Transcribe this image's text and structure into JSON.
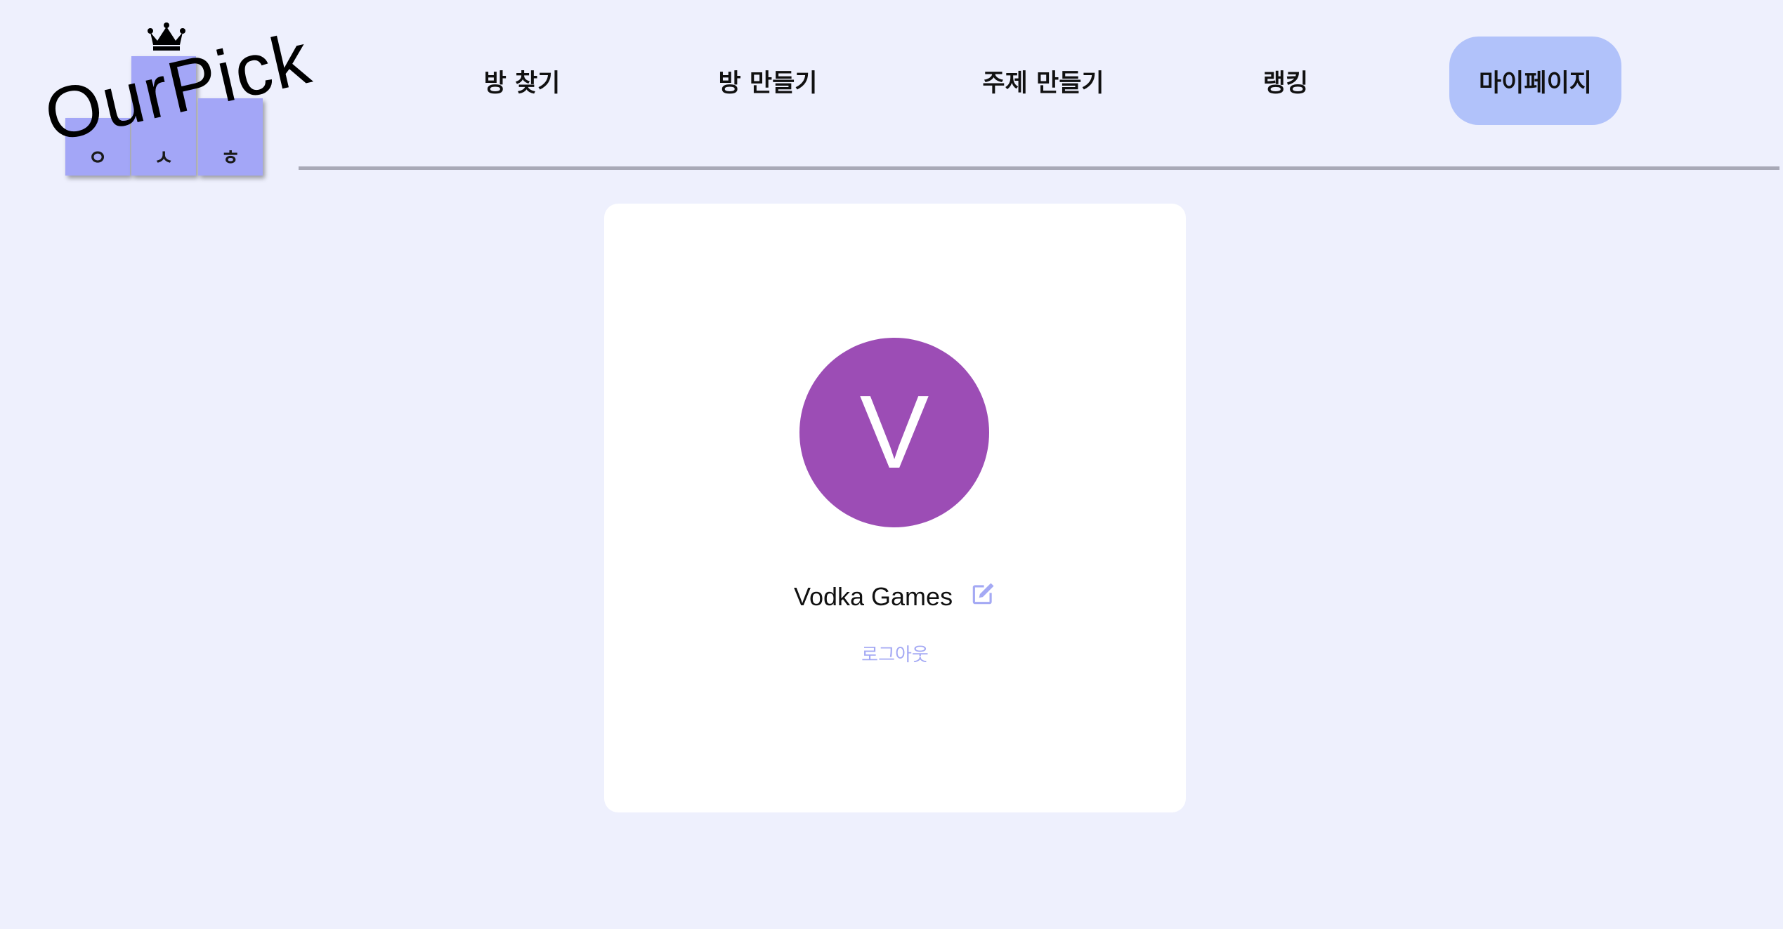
{
  "logo": {
    "text": "OurPick",
    "podium_letters": [
      "ㅇ",
      "ㅅ",
      "ㅎ"
    ],
    "crown_icon": "crown-icon"
  },
  "nav": {
    "items": [
      {
        "label": "방 찾기"
      },
      {
        "label": "방 만들기"
      },
      {
        "label": "주제 만들기"
      },
      {
        "label": "랭킹"
      },
      {
        "label": "마이페이지",
        "active": true
      }
    ]
  },
  "profile": {
    "avatar_initial": "V",
    "avatar_color": "#9c4db5",
    "user_name": "Vodka Games",
    "edit_icon": "edit-icon",
    "logout_label": "로그아웃"
  },
  "colors": {
    "background": "#eef0fd",
    "accent": "#b1c2fa",
    "podium": "#a3a6f7",
    "link": "#a4a9f4"
  }
}
